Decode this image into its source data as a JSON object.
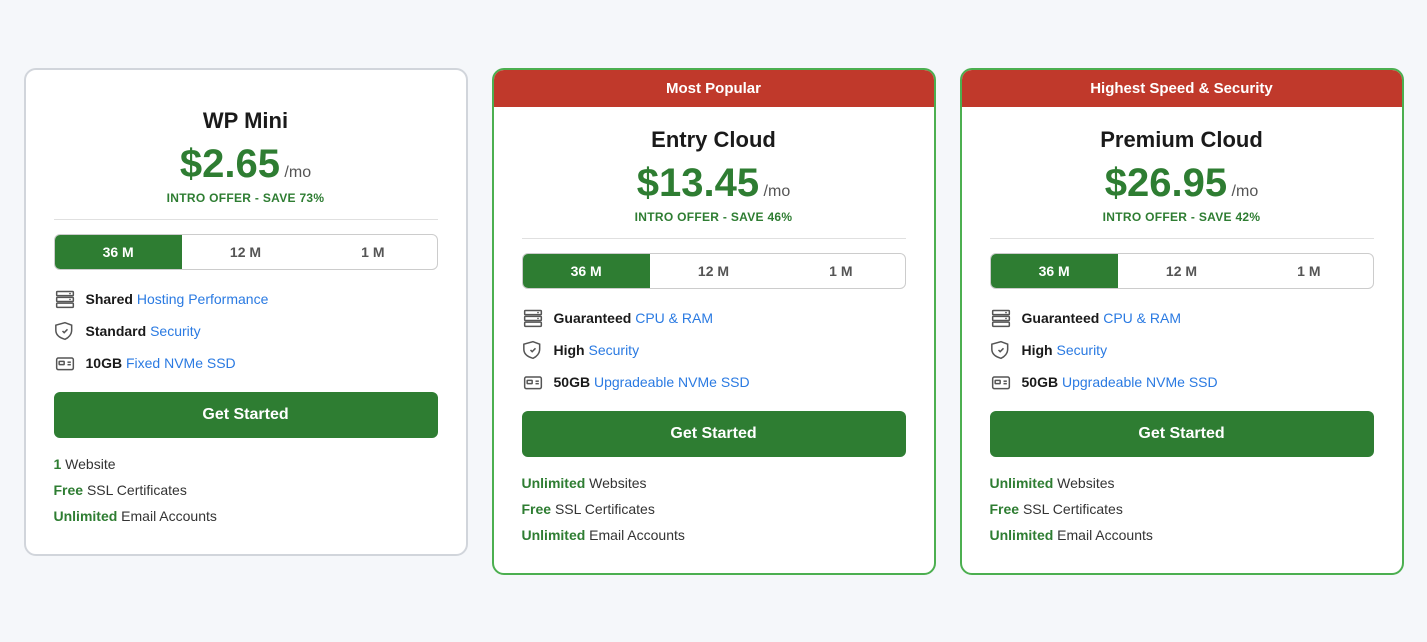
{
  "plans": [
    {
      "id": "wp-mini",
      "badge": null,
      "name": "WP Mini",
      "price": "$2.65",
      "period": "/mo",
      "intro": "INTRO OFFER - SAVE 73%",
      "terms": [
        "36 M",
        "12 M",
        "1 M"
      ],
      "active_term": 0,
      "features": [
        {
          "icon": "server",
          "bold": "Shared",
          "text": " Hosting Performance"
        },
        {
          "icon": "shield",
          "bold": "Standard",
          "text": " Security"
        },
        {
          "icon": "ssd",
          "bold": "10GB",
          "text": " Fixed NVMe SSD"
        }
      ],
      "cta": "Get Started",
      "bottom": [
        {
          "bold": "1",
          "text": " Website"
        },
        {
          "bold": "Free",
          "text": " SSL Certificates"
        },
        {
          "bold": "Unlimited",
          "text": " Email Accounts"
        }
      ]
    },
    {
      "id": "entry-cloud",
      "badge": "Most Popular",
      "badge_color": "red",
      "name": "Entry Cloud",
      "price": "$13.45",
      "period": "/mo",
      "intro": "INTRO OFFER - SAVE 46%",
      "terms": [
        "36 M",
        "12 M",
        "1 M"
      ],
      "active_term": 0,
      "features": [
        {
          "icon": "server",
          "bold": "Guaranteed",
          "text": " CPU & RAM"
        },
        {
          "icon": "shield",
          "bold": "High",
          "text": " Security"
        },
        {
          "icon": "ssd",
          "bold": "50GB",
          "text": " Upgradeable NVMe SSD"
        }
      ],
      "cta": "Get Started",
      "bottom": [
        {
          "bold": "Unlimited",
          "text": " Websites"
        },
        {
          "bold": "Free",
          "text": " SSL Certificates"
        },
        {
          "bold": "Unlimited",
          "text": " Email Accounts"
        }
      ]
    },
    {
      "id": "premium-cloud",
      "badge": "Highest Speed & Security",
      "badge_color": "red",
      "name": "Premium Cloud",
      "price": "$26.95",
      "period": "/mo",
      "intro": "INTRO OFFER - SAVE 42%",
      "terms": [
        "36 M",
        "12 M",
        "1 M"
      ],
      "active_term": 0,
      "features": [
        {
          "icon": "server",
          "bold": "Guaranteed",
          "text": " CPU & RAM"
        },
        {
          "icon": "shield",
          "bold": "High",
          "text": " Security"
        },
        {
          "icon": "ssd",
          "bold": "50GB",
          "text": " Upgradeable NVMe SSD"
        }
      ],
      "cta": "Get Started",
      "bottom": [
        {
          "bold": "Unlimited",
          "text": " Websites"
        },
        {
          "bold": "Free",
          "text": " SSL Certificates"
        },
        {
          "bold": "Unlimited",
          "text": " Email Accounts"
        }
      ]
    }
  ]
}
